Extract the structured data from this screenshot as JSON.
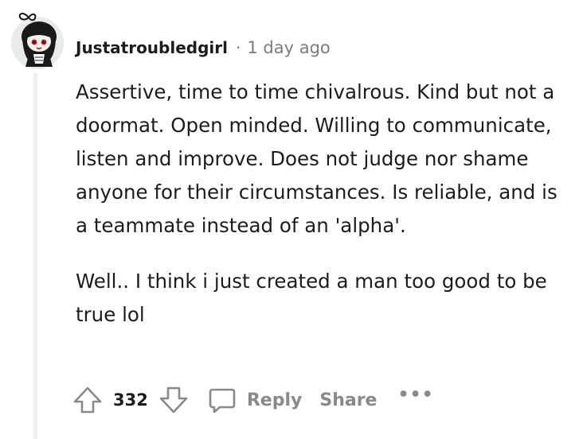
{
  "comment": {
    "username": "Justatroubledgirl",
    "separator": "·",
    "timestamp": "1 day ago",
    "paragraphs": [
      "Assertive, time to time chivalrous. Kind but not a doormat. Open minded. Willing to communicate, listen and improve. Does not judge nor shame anyone for their circumstances. Is reliable, and is a teammate instead of an 'alpha'.",
      "Well.. I think i just created a man too good to be true lol"
    ]
  },
  "actions": {
    "upvote_icon": "upvote-arrow-icon",
    "score": "332",
    "downvote_icon": "downvote-arrow-icon",
    "reply_icon": "comment-bubble-icon",
    "reply_label": "Reply",
    "share_label": "Share",
    "more_label": "•••"
  },
  "colors": {
    "text": "#1c1c1c",
    "muted": "#7c7c7c",
    "action_gray": "#878a8c",
    "thread_line": "#edeff1"
  }
}
